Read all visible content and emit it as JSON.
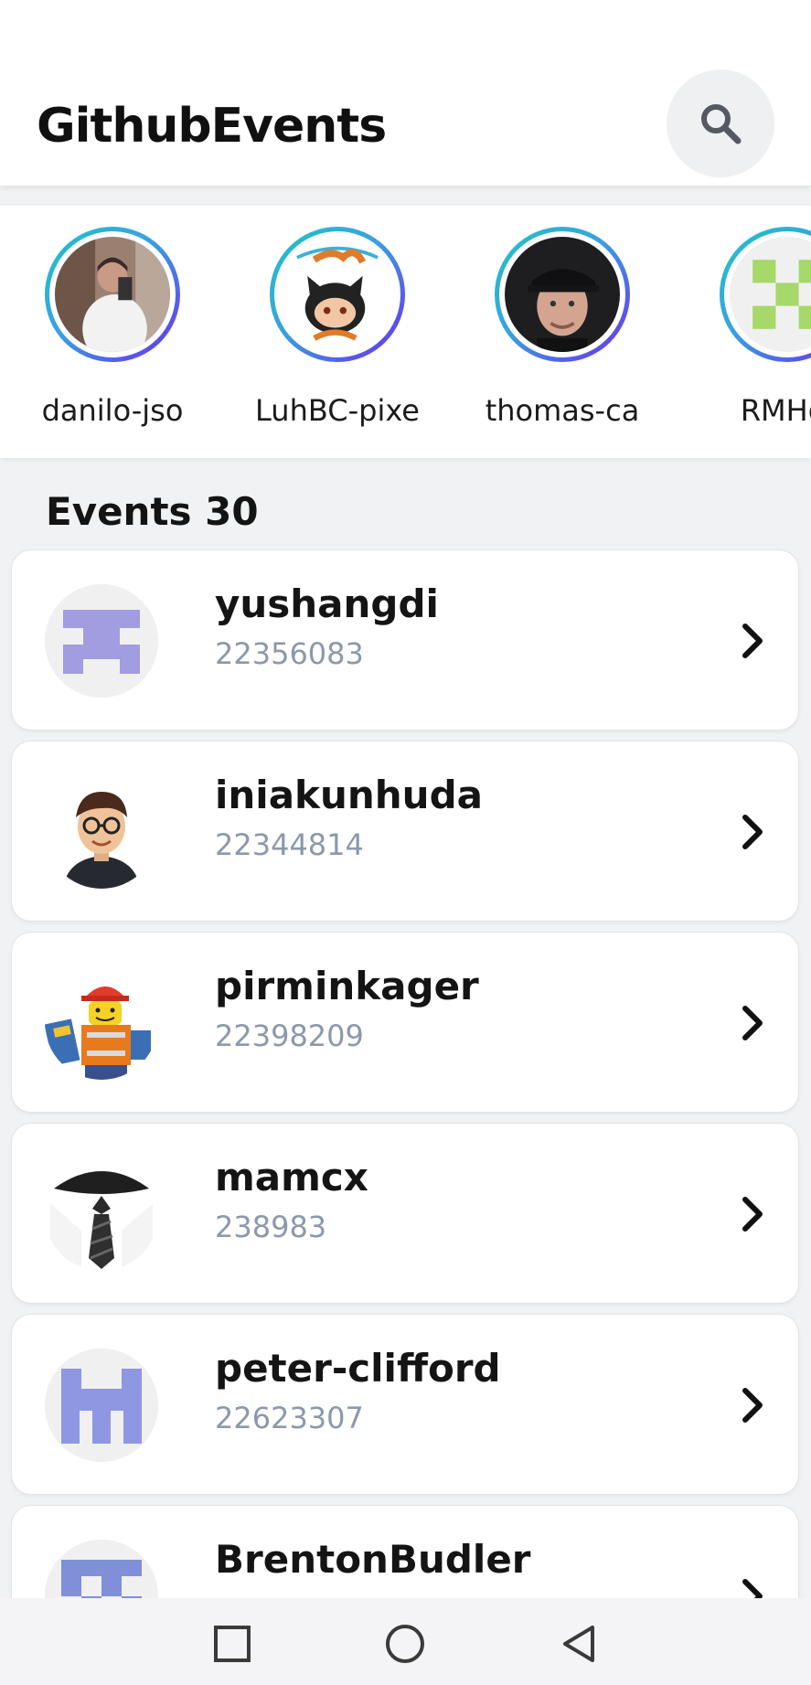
{
  "app": {
    "title": "GithubEvents"
  },
  "header": {
    "search_icon": "search-icon"
  },
  "stories": [
    {
      "name": "danilo-jso"
    },
    {
      "name": "LuhBC-pixe"
    },
    {
      "name": "thomas-ca"
    },
    {
      "name": "RMHol"
    }
  ],
  "events": {
    "label": "Events 30",
    "items": [
      {
        "name": "yushangdi",
        "id": "22356083"
      },
      {
        "name": "iniakunhuda",
        "id": "22344814"
      },
      {
        "name": "pirminkager",
        "id": "22398209"
      },
      {
        "name": "mamcx",
        "id": "238983"
      },
      {
        "name": "peter-clifford",
        "id": "22623307"
      },
      {
        "name": "BrentonBudler",
        "id": ""
      }
    ]
  },
  "colors": {
    "accent_ring_start": "#1ec6c6",
    "accent_ring_end": "#6a2cf0",
    "id_text": "#8c98ab"
  },
  "navbar": {
    "icons": [
      "recents-square-icon",
      "home-circle-icon",
      "back-triangle-icon"
    ]
  }
}
